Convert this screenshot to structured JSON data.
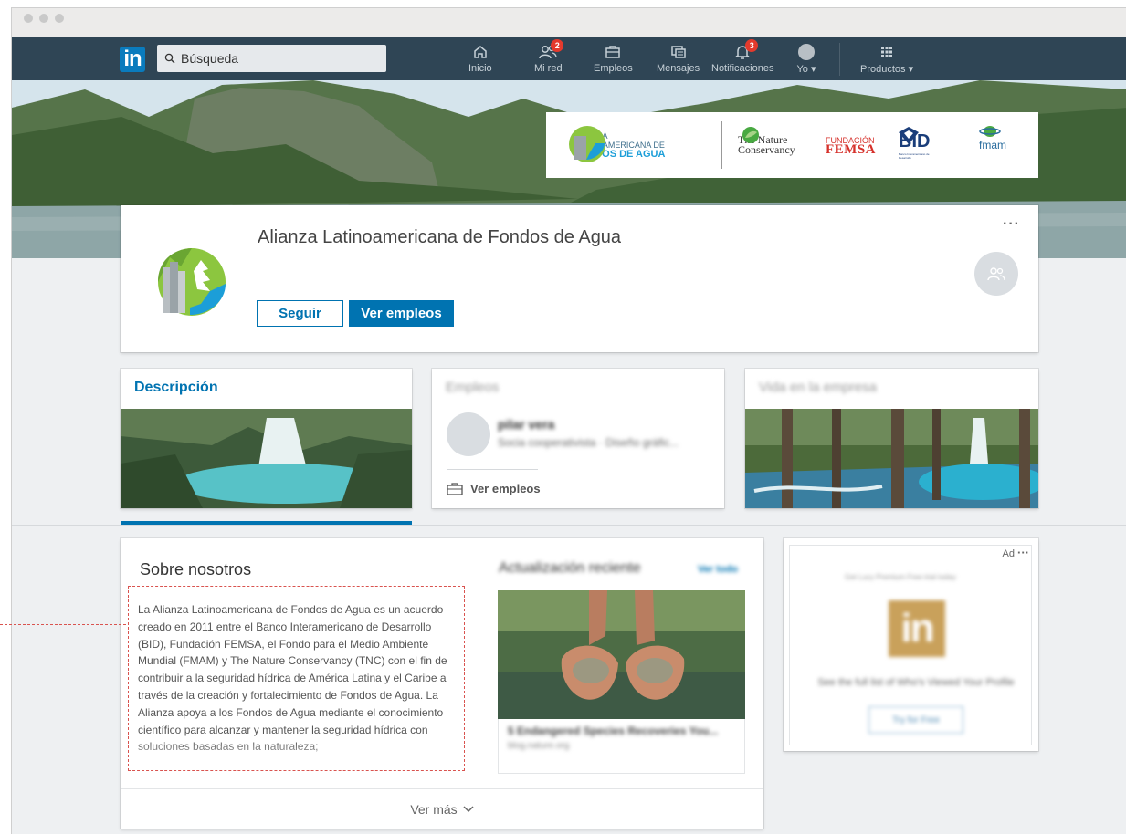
{
  "nav": {
    "logo": "in",
    "search_placeholder": "Búsqueda",
    "items": [
      {
        "label": "Inicio",
        "badge": ""
      },
      {
        "label": "Mi red",
        "badge": "2"
      },
      {
        "label": "Empleos",
        "badge": ""
      },
      {
        "label": "Mensajes",
        "badge": ""
      },
      {
        "label": "Notificaciones",
        "badge": "3"
      },
      {
        "label": "Yo",
        "badge": ""
      },
      {
        "label": "Productos",
        "badge": ""
      }
    ]
  },
  "partners": {
    "alianza_line1": "ALIANZA",
    "alianza_line2": "LATINOAMERICANA DE",
    "alianza_line3": "FONDOS DE AGUA",
    "tnc_line1": "The Nature",
    "tnc_line2": "Conservancy",
    "femsa_line1": "FUNDACIÓN",
    "femsa_line2": "FEMSA",
    "bid": "BID",
    "bid_sub": "Banco Interamericano de Desarrollo",
    "fmam": "fmam"
  },
  "company": {
    "name": "Alianza Latinoamericana de Fondos de Agua",
    "follow_label": "Seguir",
    "jobs_label": "Ver empleos",
    "more": "···"
  },
  "tabs": {
    "description": "Descripción",
    "jobs": "Empleos",
    "life": "Vida en la empresa",
    "jobs_person_name": "pilar vera",
    "jobs_person_role": "Socia cooperativista · Diseño gráfic...",
    "jobs_link": "Ver empleos"
  },
  "about": {
    "title": "Sobre nosotros",
    "text": "La Alianza Latinoamericana de Fondos de Agua es un acuerdo creado en 2011 entre el Banco Interamericano de Desarrollo (BID), Fundación FEMSA, el Fondo para el Medio Ambiente Mundial (FMAM) y The Nature Conservancy (TNC) con el fin de contribuir a la seguridad hídrica de América Latina y el Caribe a través de la creación y fortalecimiento de Fondos de Agua. La Alianza apoya a los Fondos de Agua mediante el conocimiento científico para alcanzar y mantener la seguridad hídrica con soluciones basadas en la naturaleza;",
    "more_label": "Ver más",
    "update_title": "Actualización reciente",
    "update_link": "Ver todo",
    "update_caption": "5 Endangered Species Recoveries You...",
    "update_source": "blog.nature.org"
  },
  "ad": {
    "label": "Ad",
    "dots": "···",
    "top_text": "Get Lucy Premium Free trial today",
    "logo": "in",
    "text": "See the full list of Who's Viewed Your Profile",
    "button": "Try for Free"
  },
  "colors": {
    "nav_bg": "#2f4555",
    "brand_blue": "#0073b1",
    "badge_red": "#e33a2d",
    "annotation_red": "#d9534f"
  }
}
